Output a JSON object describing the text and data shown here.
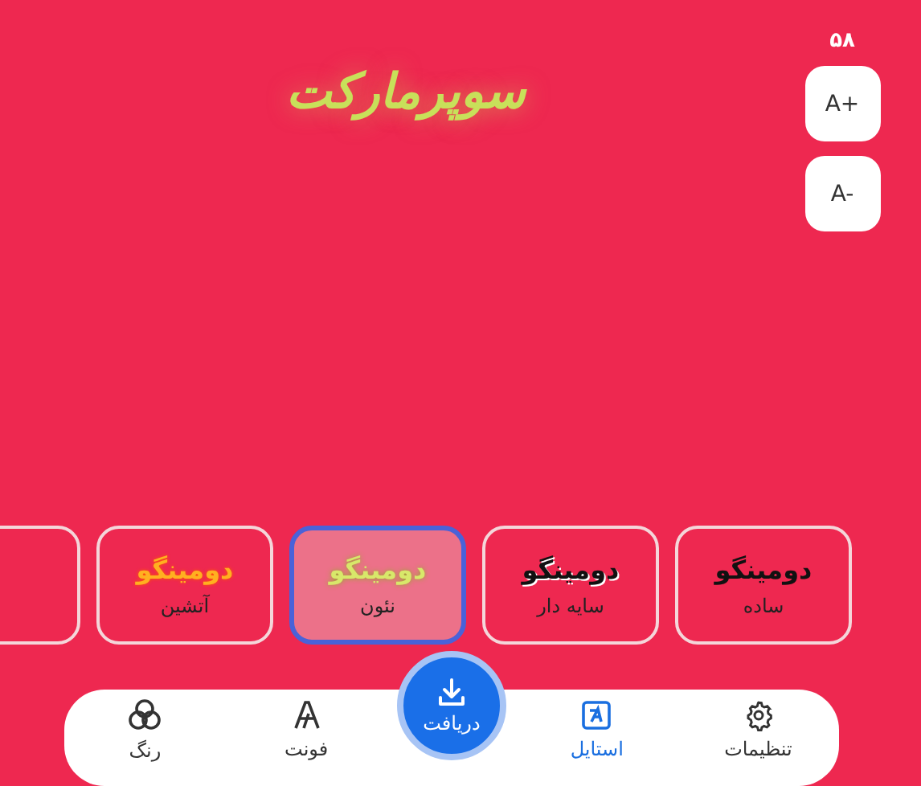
{
  "font_size": "۵۸",
  "preview": {
    "text": "سوپرمارکت"
  },
  "size_buttons": [
    "A+",
    "A-"
  ],
  "styles": [
    {
      "sample": "دومینگو",
      "label": "ساده",
      "kind": "plain",
      "selected": false
    },
    {
      "sample": "دومینگو",
      "label": "سایه دار",
      "kind": "shadow",
      "selected": false
    },
    {
      "sample": "دومینگو",
      "label": "نئون",
      "kind": "neon",
      "selected": true
    },
    {
      "sample": "دومینگو",
      "label": "آتشین",
      "kind": "fire",
      "selected": false
    }
  ],
  "nav": [
    {
      "label": "تنظیمات",
      "kind": "settings",
      "selected": false
    },
    {
      "label": "استایل",
      "kind": "style",
      "selected": true
    },
    {
      "label": "دریافت",
      "kind": "download"
    },
    {
      "label": "فونت",
      "kind": "font",
      "selected": false
    },
    {
      "label": "رنگ",
      "kind": "color",
      "selected": false
    }
  ]
}
